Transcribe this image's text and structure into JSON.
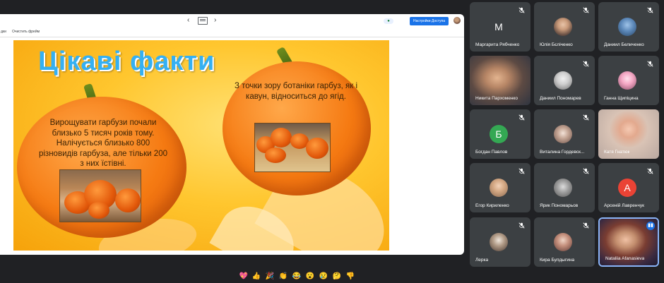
{
  "share": {
    "nav_prev": "‹",
    "nav_next": "›",
    "access_button": "Настройки Доступа",
    "toolbar_left": "дки",
    "toolbar_item": "Очистить фрейм"
  },
  "slide": {
    "title": "Цікаві факти",
    "fact1": "Вирощувати гарбузи почали близько 5 тисяч років тому. Налічується близько 800 різновидів гарбуза, але тільки 200 з них їстівні.",
    "fact2": "З точки зору ботаніки гарбуз, як і кавун, відноситься до ягід."
  },
  "participants": [
    {
      "name": "Маргарита Рябченко",
      "avatar_letter": "М",
      "avatar_color": "#0f6b4f"
    },
    {
      "name": "Юлія Бєліченко",
      "avatar_letter": ""
    },
    {
      "name": "Даниил Беличенко",
      "avatar_letter": ""
    },
    {
      "name": "Никита Пархоменко",
      "avatar_letter": ""
    },
    {
      "name": "Даниил Пономарев",
      "avatar_letter": ""
    },
    {
      "name": "Ганна Щипіцина",
      "avatar_letter": ""
    },
    {
      "name": "Богдан Павлов",
      "avatar_letter": "Б",
      "avatar_color": "#34a853"
    },
    {
      "name": "Виталина Гордевск...",
      "avatar_letter": ""
    },
    {
      "name": "Катя Гнатюк",
      "avatar_letter": ""
    },
    {
      "name": "Егор Кириленко",
      "avatar_letter": ""
    },
    {
      "name": "Ярик Пономарьов",
      "avatar_letter": ""
    },
    {
      "name": "Арсеній Лавренчук",
      "avatar_letter": "А",
      "avatar_color": "#ea4335"
    },
    {
      "name": "Лерка",
      "avatar_letter": ""
    },
    {
      "name": "Кира Булдыгина",
      "avatar_letter": ""
    },
    {
      "name": "Nataliia Afanasieva",
      "avatar_letter": ""
    }
  ],
  "reactions": [
    "💖",
    "👍",
    "🎉",
    "👏",
    "😂",
    "😮",
    "😢",
    "🤔",
    "👎"
  ]
}
